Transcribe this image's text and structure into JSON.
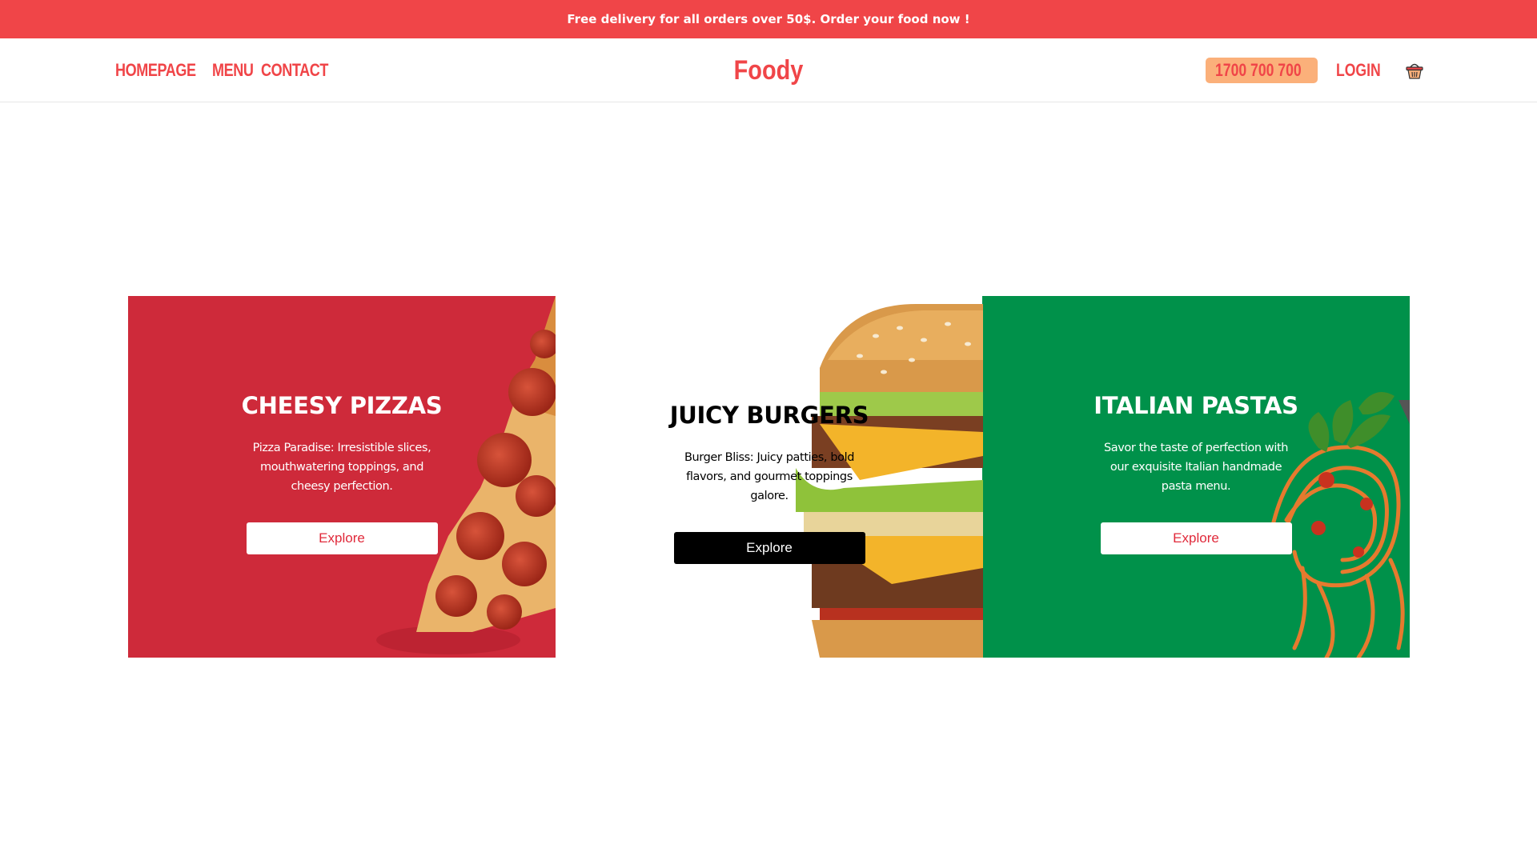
{
  "announcement": "Free delivery for all orders over 50$. Order your food now !",
  "nav": {
    "links": [
      "HOMEPAGE",
      "MENU",
      "CONTACT"
    ],
    "logo": "Foody",
    "phone": "1700 700 700",
    "login": "LOGIN",
    "cart_icon": "basket-icon",
    "phone_icon": "phone-icon"
  },
  "colors": {
    "brand_red": "#f04548",
    "pizza_bg": "#ce2a3a",
    "pasta_bg": "#00914a",
    "phone_pill": "#fbb07a"
  },
  "cards": [
    {
      "title": "CHEESY PIZZAS",
      "description": "Pizza Paradise: Irresistible slices, mouthwatering toppings, and cheesy perfection.",
      "button": "Explore",
      "image": "pizza-slice-image"
    },
    {
      "title": "JUICY BURGERS",
      "description": "Burger Bliss: Juicy patties, bold flavors, and gourmet toppings galore.",
      "button": "Explore",
      "image": "burger-image"
    },
    {
      "title": "ITALIAN PASTAS",
      "description": "Savor the taste of perfection with our exquisite Italian handmade pasta menu.",
      "button": "Explore",
      "image": "spaghetti-image"
    }
  ]
}
